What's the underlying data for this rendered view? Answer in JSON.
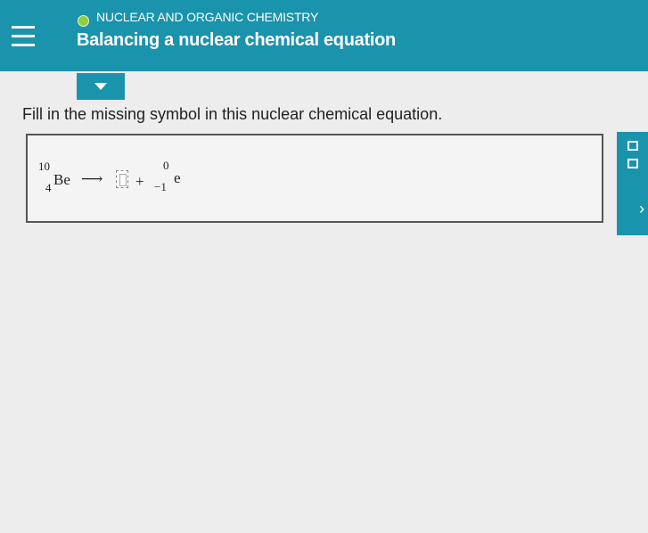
{
  "header": {
    "topic": "NUCLEAR AND ORGANIC CHEMISTRY",
    "title": "Balancing a nuclear chemical equation",
    "status_color": "#8fcf3a",
    "accent_color": "#1a93ad"
  },
  "question": {
    "prompt": "Fill in the missing symbol in this nuclear chemical equation."
  },
  "equation": {
    "reactant": {
      "mass": "10",
      "atomic": "4",
      "symbol": "Be"
    },
    "arrow": "⟶",
    "plus": "+",
    "product2": {
      "mass": "0",
      "atomic": "−1",
      "symbol": "e"
    }
  },
  "side_panel": {
    "icons": [
      "subscript-superscript-icon",
      "chevron-right-icon"
    ],
    "chevron": "›"
  }
}
